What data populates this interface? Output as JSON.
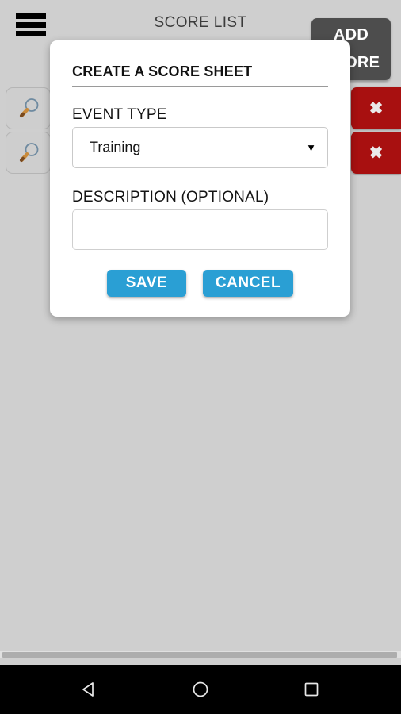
{
  "statusbar": {},
  "topbar": {
    "menu_icon": "hamburger-menu-icon",
    "title": "SCORE LIST",
    "add_score_line1": "ADD",
    "add_score_line2": "SCORE"
  },
  "score_rows": [
    {
      "search_icon": "magnifier-icon",
      "delete_icon": "close-x-icon",
      "delete_label": "✖"
    },
    {
      "search_icon": "magnifier-icon",
      "delete_icon": "close-x-icon",
      "delete_label": "✖"
    }
  ],
  "dialog": {
    "title": "CREATE A SCORE SHEET",
    "event_type": {
      "label": "EVENT TYPE",
      "selected": "Training",
      "caret": "▼"
    },
    "description": {
      "label": "DESCRIPTION (OPTIONAL)",
      "value": "",
      "placeholder": ""
    },
    "save_label": "SAVE",
    "cancel_label": "CANCEL"
  },
  "navbar": {
    "back": "back-triangle-icon",
    "home": "home-circle-icon",
    "recents": "recents-square-icon"
  },
  "colors": {
    "page_background": "#cfcfcf",
    "accent_blue": "#2a9fd4",
    "delete_red": "#a81010",
    "add_button_gray": "#4d4d4d",
    "dialog_white": "#ffffff",
    "navbar_black": "#000000"
  }
}
